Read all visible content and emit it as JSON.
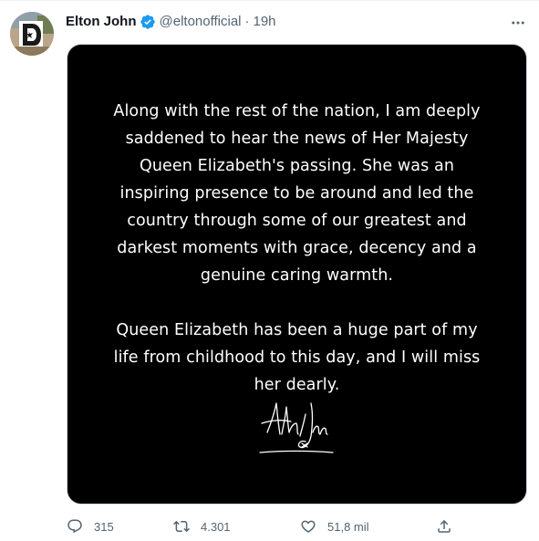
{
  "tweet": {
    "author": {
      "display_name": "Elton John",
      "handle": "@eltonofficial",
      "verified_icon": "verified-badge-icon"
    },
    "separator": "·",
    "time": "19h",
    "statement_image": {
      "paragraph_1": "Along with the rest of the nation, I am deeply saddened to hear the news of Her Majesty Queen Elizabeth's passing. She was an inspiring presence to be around and led the country through some of our greatest and darkest moments with grace, decency and a genuine caring warmth.",
      "paragraph_2": "Queen Elizabeth has been a huge part of my life from childhood to this day, and I will miss her dearly.",
      "signature": "Elton John"
    },
    "actions": {
      "reply_count": "315",
      "retweet_count": "4.301",
      "like_count": "51,8 mil"
    }
  },
  "colors": {
    "text_primary": "#0f1419",
    "text_secondary": "#536471",
    "verified_blue": "#1d9bf0",
    "image_background": "#000000"
  }
}
